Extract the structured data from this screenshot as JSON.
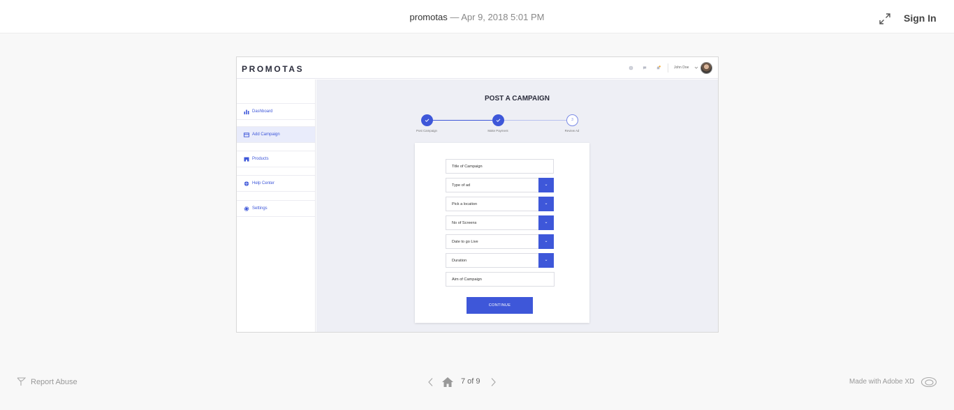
{
  "topbar": {
    "app_name": "promotas",
    "separator": " — ",
    "timestamp": "Apr 9, 2018 5:01 PM",
    "sign_in_label": "Sign In"
  },
  "app": {
    "logo": "PROMOTAS",
    "user_name": "John Doe",
    "sidebar": {
      "items": [
        {
          "label": "Dashboard",
          "icon": "bar-chart-icon",
          "active": false
        },
        {
          "label": "Add Campaign",
          "icon": "credit-card-icon",
          "active": true
        },
        {
          "label": "Products",
          "icon": "store-icon",
          "active": false
        },
        {
          "label": "Help Center",
          "icon": "globe-icon",
          "active": false
        },
        {
          "label": "Settings",
          "icon": "gear-icon",
          "active": false
        }
      ]
    },
    "main": {
      "title": "POST A CAMPAIGN",
      "steps": [
        {
          "label": "Post Campaign",
          "status": "done"
        },
        {
          "label": "Make Payment",
          "status": "done"
        },
        {
          "label": "Review Ad",
          "status": "pending",
          "number": "3"
        }
      ],
      "form": {
        "fields": [
          {
            "label": "Title of Campaign",
            "dropdown": false
          },
          {
            "label": "Type of ad",
            "dropdown": true
          },
          {
            "label": "Pick a location",
            "dropdown": true
          },
          {
            "label": "No of Screens",
            "dropdown": true
          },
          {
            "label": "Date to go Live",
            "dropdown": true
          },
          {
            "label": "Duration",
            "dropdown": true
          },
          {
            "label": "Aim of Campaign",
            "dropdown": false
          }
        ],
        "submit_label": "CONTINUE"
      }
    }
  },
  "footer": {
    "report_abuse": "Report Abuse",
    "page_counter": "7 of 9",
    "made_with": "Made with Adobe XD"
  },
  "colors": {
    "accent": "#3e57d9",
    "main_bg": "#eeeff5",
    "active_nav_bg": "#e9ecfb"
  }
}
